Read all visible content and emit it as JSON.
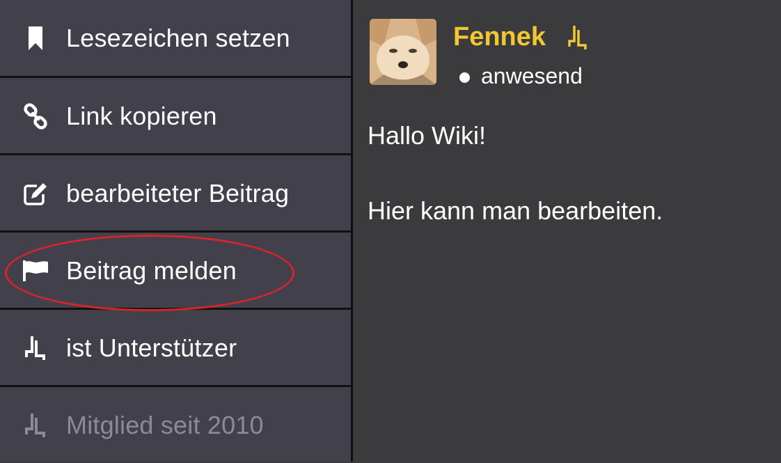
{
  "menu": {
    "items": [
      {
        "label": "Lesezeichen setzen",
        "icon": "bookmark-icon"
      },
      {
        "label": "Link kopieren",
        "icon": "link-icon"
      },
      {
        "label": "bearbeiteter Beitrag",
        "icon": "edit-icon"
      },
      {
        "label": "Beitrag melden",
        "icon": "flag-icon",
        "highlighted": true
      },
      {
        "label": "ist Unterstützer",
        "icon": "supporter-icon"
      },
      {
        "label": "Mitglied seit 2010",
        "icon": "supporter-icon",
        "disabled": true
      }
    ]
  },
  "post": {
    "author": {
      "name": "Fennek",
      "status": "anwesend",
      "badge_icon": "supporter-icon",
      "avatar_icon": "fennec-fox-avatar"
    },
    "content": [
      "Hallo Wiki!",
      "Hier kann man bearbeiten."
    ]
  },
  "colors": {
    "menu_bg": "#42414b",
    "post_bg": "#3b3b3d",
    "username": "#f2c832",
    "highlight": "#d8232a",
    "disabled_text": "#8c8b93"
  }
}
